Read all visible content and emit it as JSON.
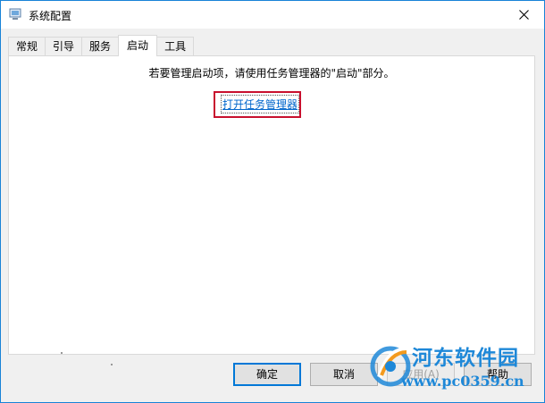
{
  "window": {
    "title": "系统配置",
    "close_glyph": "✕"
  },
  "tabs": [
    {
      "label": "常规",
      "active": false
    },
    {
      "label": "引导",
      "active": false
    },
    {
      "label": "服务",
      "active": false
    },
    {
      "label": "启动",
      "active": true
    },
    {
      "label": "工具",
      "active": false
    }
  ],
  "startup": {
    "message": "若要管理启动项，请使用任务管理器的\"启动\"部分。",
    "task_manager_link": "打开任务管理器"
  },
  "buttons": {
    "ok": "确定",
    "cancel": "取消",
    "apply": "应用(A)",
    "help": "帮助"
  },
  "watermark": {
    "brand": "河东软件园",
    "url": "www.pc0359.cn"
  },
  "colors": {
    "highlight": "#c8102e",
    "link": "#0066cc",
    "accent": "#0078d7",
    "watermark": "#1e88d8"
  }
}
